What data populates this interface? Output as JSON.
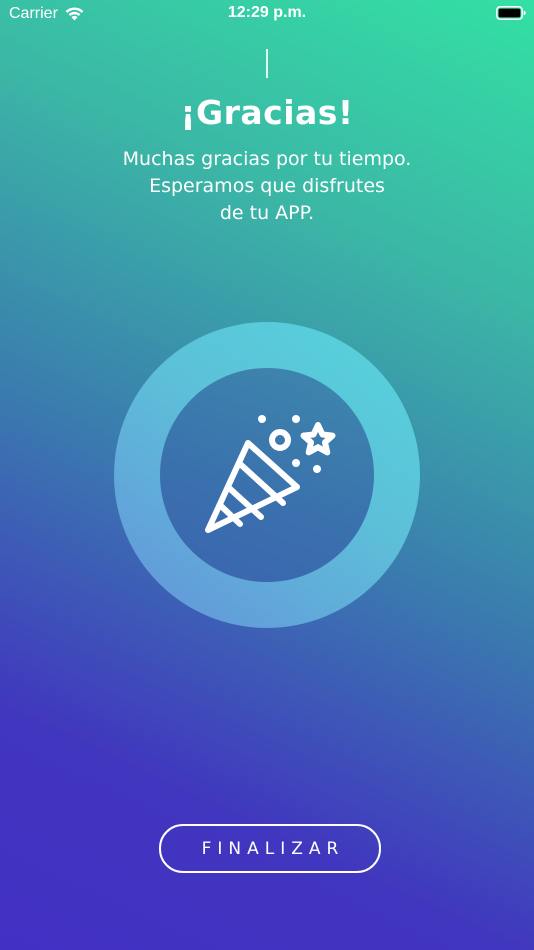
{
  "status_bar": {
    "carrier": "Carrier",
    "time": "12:29 p.m.",
    "wifi_icon": "wifi-icon",
    "battery_icon": "battery-icon"
  },
  "main": {
    "title": "¡Gracias!",
    "message_lines": [
      "Muchas gracias por tu tiempo.",
      "Esperamos que disfrutes",
      "de tu APP."
    ],
    "illustration_icon": "party-popper-icon"
  },
  "footer": {
    "finish_label": "FINALIZAR"
  },
  "colors": {
    "gradient_top_right": "#33e0a4",
    "gradient_bottom_left": "#4230c4",
    "ring": "#5dbfd9",
    "ring_inner": "#3a72ad",
    "text": "#ffffff"
  }
}
